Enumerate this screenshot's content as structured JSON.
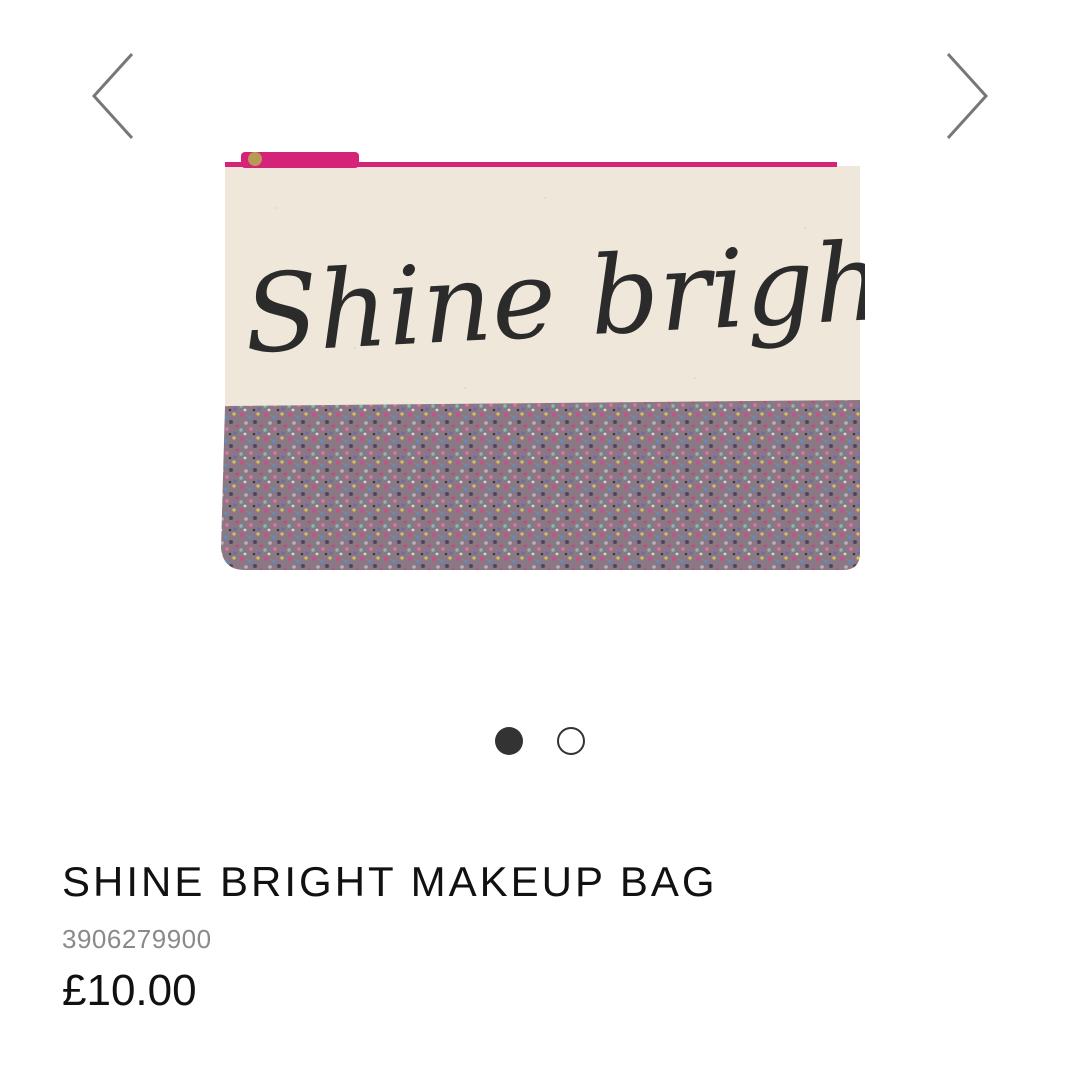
{
  "carousel": {
    "prev_icon": "chevron-left-icon",
    "next_icon": "chevron-right-icon",
    "image_text": "Shine bright",
    "slides": [
      {
        "state": "active"
      },
      {
        "state": "inactive"
      }
    ],
    "active_index": 0
  },
  "product": {
    "title": "SHINE BRIGHT MAKEUP BAG",
    "sku": "3906279900",
    "price": "£10.00"
  },
  "colors": {
    "zip_pink": "#d6237a",
    "canvas": "#efe8da",
    "ink": "#2b2b2b",
    "glitter_base": "#8a7884"
  }
}
